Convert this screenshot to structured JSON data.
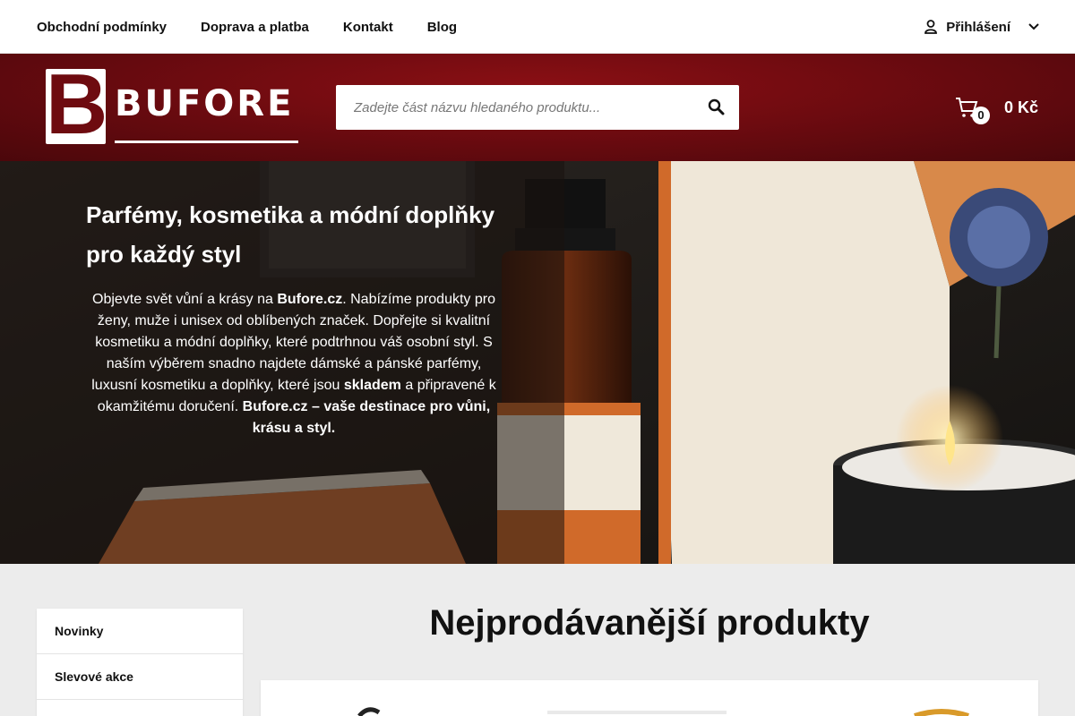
{
  "topnav": {
    "links": [
      "Obchodní podmínky",
      "Doprava a platba",
      "Kontakt",
      "Blog"
    ],
    "login_label": "Přihlášení"
  },
  "header": {
    "logo_text": "BUFORE",
    "logo_letter": "B",
    "search_placeholder": "Zadejte část názvu hledaného produktu...",
    "cart_count": "0",
    "cart_price": "0 Kč"
  },
  "hero": {
    "title": "Parfémy, kosmetika a módní doplňky pro každý styl",
    "text": {
      "p1": "Objevte svět vůní a krásy na ",
      "brand1": "Bufore.cz",
      "p2": ". Nabízíme produkty pro ženy, muže i unisex od oblíbených značek. Dopřejte si kvalitní kosmetiku a módní doplňky, které podtrhnou váš osobní styl. S naším výběrem snadno najdete dámské a pánské parfémy, luxusní kosmetiku a doplňky, které jsou ",
      "instock": "skladem",
      "p3": " a připravené k okamžitému doručení. ",
      "tagline": "Bufore.cz – vaše destinace pro vůni, krásu a styl."
    }
  },
  "sidebar": {
    "items": [
      "Novinky",
      "Slevové akce"
    ]
  },
  "main": {
    "section_title": "Nejprodávanější produkty"
  },
  "colors": {
    "brand_red": "#6e0b10",
    "header_bg": "#7a0d12",
    "page_bg": "#ececec"
  }
}
